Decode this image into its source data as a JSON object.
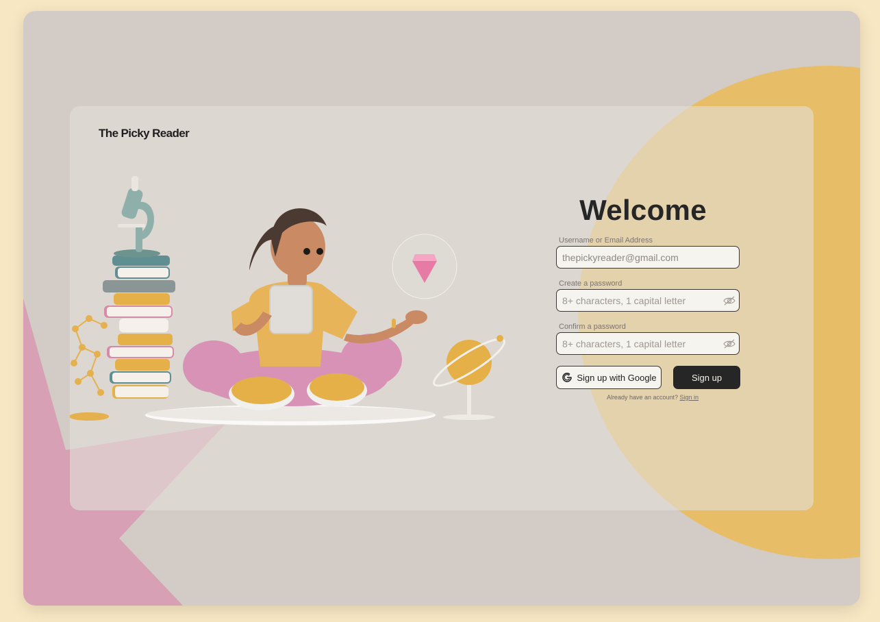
{
  "brand": {
    "name": "The Picky Reader"
  },
  "form": {
    "title": "Welcome",
    "username": {
      "label": "Username or Email Address",
      "value": "thepickyreader@gmail.com"
    },
    "password": {
      "label": "Create a password",
      "placeholder": "8+ characters, 1 capital letter"
    },
    "confirm": {
      "label": "Confirm a password",
      "placeholder": "8+ characters, 1 capital letter"
    },
    "google_button": "Sign up with Google",
    "signup_button": "Sign up",
    "already_text": "Already have an account?",
    "signin_link": "Sign in"
  },
  "icons": {
    "password_toggle": "eye-off-icon",
    "google": "google-icon"
  },
  "colors": {
    "page_background": "#f7e7c3",
    "frame": "#d3cbc5",
    "accent_yellow": "#e8bd68",
    "accent_pink": "#d8a0b4",
    "button_dark": "#262626"
  }
}
